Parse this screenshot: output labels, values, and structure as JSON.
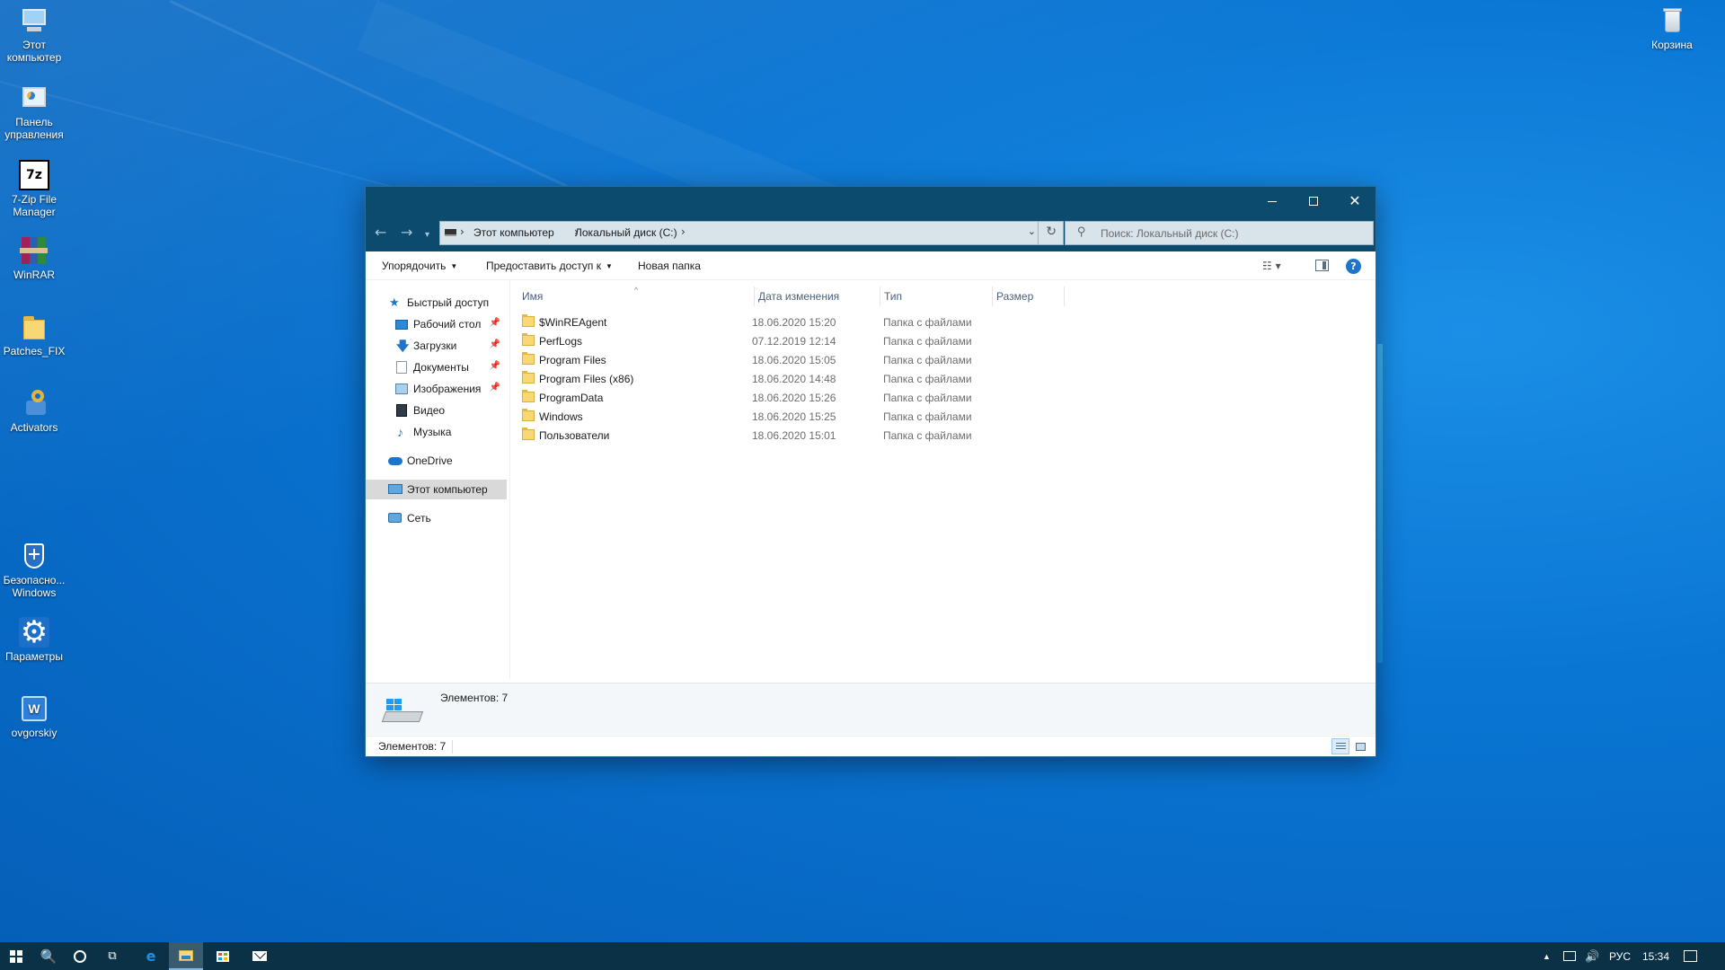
{
  "desktop": {
    "icons_left": [
      {
        "label": "Этот\nкомпьютер",
        "icon": "this-pc-icon"
      },
      {
        "label": "Панель\nуправления",
        "icon": "control-panel-icon"
      },
      {
        "label": "7-Zip File\nManager",
        "icon": "7zip-icon",
        "glyph": "7z"
      },
      {
        "label": "WinRAR",
        "icon": "winrar-icon"
      },
      {
        "label": "Patches_FIX",
        "icon": "folder-icon"
      },
      {
        "label": "Activators",
        "icon": "activators-icon"
      },
      {
        "label": "Безопасно...\nWindows",
        "icon": "windows-security-icon"
      },
      {
        "label": "Параметры",
        "icon": "settings-gear-icon",
        "glyph": "⚙"
      },
      {
        "label": "ovgorskiy",
        "icon": "ovgorskiy-icon",
        "glyph": "W"
      }
    ],
    "recycle_bin": {
      "label": "Корзина",
      "icon": "recycle-bin-icon"
    }
  },
  "window": {
    "controls": {
      "minimize": "minimize",
      "maximize": "maximize",
      "close": "✕"
    },
    "nav": {
      "back": "←",
      "forward": "→",
      "recent": "▾"
    },
    "address": {
      "crumbs": [
        "Этот компьютер",
        "Локальный диск (C:)"
      ],
      "chevron": "›",
      "dropdown": "⌄",
      "refresh": "↻"
    },
    "search": {
      "icon": "⚲",
      "placeholder": "Поиск: Локальный диск (C:)"
    },
    "ribbon": {
      "organize": "Упорядочить",
      "share": "Предоставить доступ к",
      "new_folder": "Новая папка",
      "caret": "▼",
      "views_glyph": "☷ ▾",
      "help": "?"
    },
    "navpane": {
      "items": [
        {
          "label": "Быстрый доступ",
          "icon": "star"
        },
        {
          "label": "Рабочий стол",
          "icon": "desktop",
          "pinned": true
        },
        {
          "label": "Загрузки",
          "icon": "downloads",
          "pinned": true
        },
        {
          "label": "Документы",
          "icon": "documents",
          "pinned": true
        },
        {
          "label": "Изображения",
          "icon": "pictures",
          "pinned": true
        },
        {
          "label": "Видео",
          "icon": "videos"
        },
        {
          "label": "Музыка",
          "icon": "music"
        },
        {
          "label": "OneDrive",
          "icon": "onedrive"
        },
        {
          "label": "Этот компьютер",
          "icon": "this-pc",
          "selected": true
        },
        {
          "label": "Сеть",
          "icon": "network"
        }
      ],
      "pin_glyph": "📌",
      "star_glyph": "★",
      "down_glyph": "🡇",
      "music_glyph": "♪"
    },
    "columns": {
      "name": "Имя",
      "date": "Дата изменения",
      "type": "Тип",
      "size": "Размер",
      "sort_glyph": "^"
    },
    "files": [
      {
        "name": "$WinREAgent",
        "date": "18.06.2020 15:20",
        "type": "Папка с файлами"
      },
      {
        "name": "PerfLogs",
        "date": "07.12.2019 12:14",
        "type": "Папка с файлами"
      },
      {
        "name": "Program Files",
        "date": "18.06.2020 15:05",
        "type": "Папка с файлами"
      },
      {
        "name": "Program Files (x86)",
        "date": "18.06.2020 14:48",
        "type": "Папка с файлами"
      },
      {
        "name": "ProgramData",
        "date": "18.06.2020 15:26",
        "type": "Папка с файлами"
      },
      {
        "name": "Windows",
        "date": "18.06.2020 15:25",
        "type": "Папка с файлами"
      },
      {
        "name": "Пользователи",
        "date": "18.06.2020 15:01",
        "type": "Папка с файлами"
      }
    ],
    "details_pane": {
      "count": "Элементов: 7"
    },
    "status": {
      "count": "Элементов: 7"
    }
  },
  "taskbar": {
    "search_glyph": "🔍",
    "tasks_glyph": "⧉",
    "edge_glyph": "e",
    "tray": {
      "up": "▲",
      "volume": "🔊",
      "lang": "РУС",
      "time": "15:34"
    }
  },
  "colors": {
    "titlebar": "#0c4b6e",
    "taskbar": "#0a3146",
    "accent": "#1c75c9",
    "folder": "#f8d775"
  }
}
